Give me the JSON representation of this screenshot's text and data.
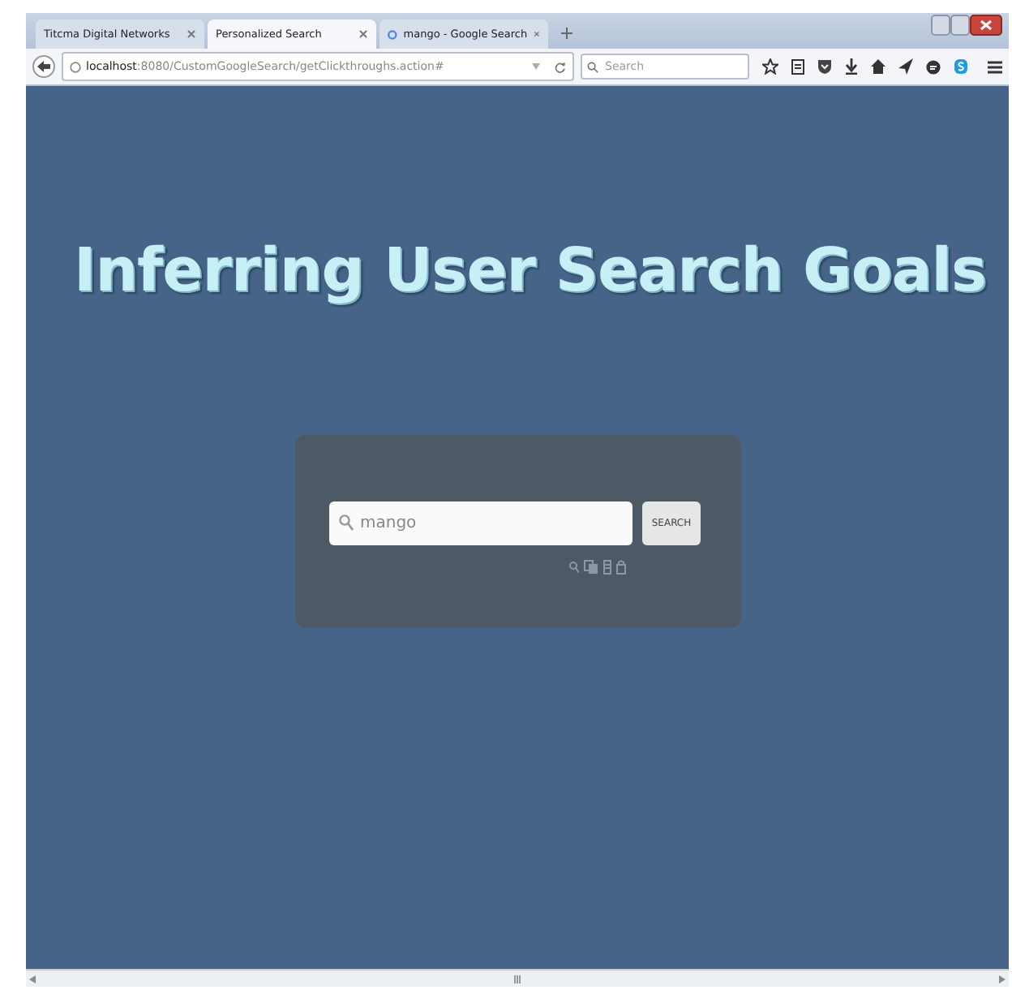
{
  "tabs": [
    {
      "label": "Titcma Digital Networks",
      "selected": false,
      "favicon": false
    },
    {
      "label": "Personalized Search",
      "selected": true,
      "favicon": false
    },
    {
      "label": "mango - Google Search",
      "selected": false,
      "favicon": true
    }
  ],
  "address_bar": {
    "host": "localhost",
    "path": ":8080/CustomGoogleSearch/getClickthroughs.action#"
  },
  "browser_search": {
    "placeholder": "Search"
  },
  "page": {
    "heading": "Inferring User Search Goals",
    "search_field": {
      "value": "mango"
    },
    "search_button": "SEARCH"
  }
}
